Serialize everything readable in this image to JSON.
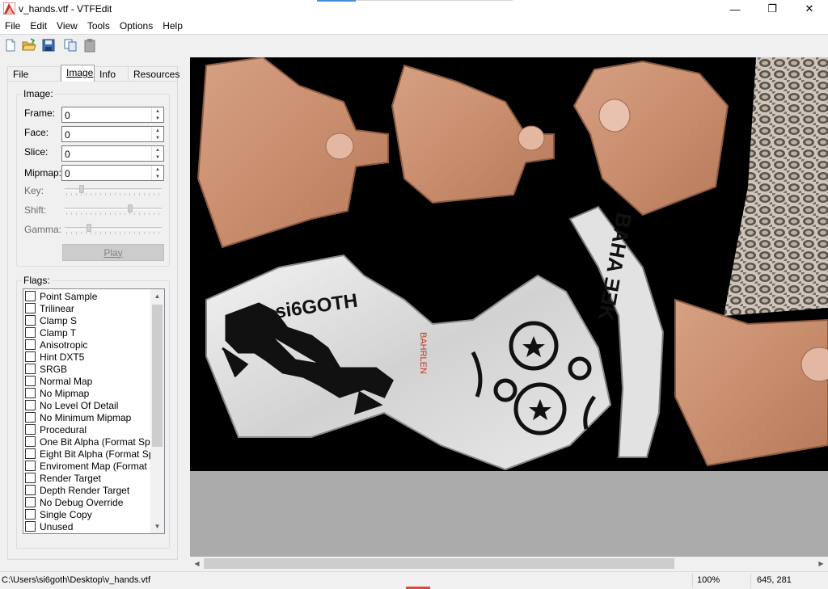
{
  "window": {
    "title": "v_hands.vtf - VTFEdit",
    "minimize_glyph": "—",
    "maximize_glyph": "❐",
    "close_glyph": "✕"
  },
  "menu": [
    {
      "label": "File"
    },
    {
      "label": "Edit"
    },
    {
      "label": "View"
    },
    {
      "label": "Tools"
    },
    {
      "label": "Options"
    },
    {
      "label": "Help"
    }
  ],
  "toolbar": {
    "icons": [
      "new-file-icon",
      "open-folder-icon",
      "save-disk-icon",
      "copy-icon",
      "paste-icon"
    ]
  },
  "tabs": [
    {
      "label": "File System"
    },
    {
      "label": "Image",
      "active": true
    },
    {
      "label": "Info"
    },
    {
      "label": "Resources"
    }
  ],
  "image_group": {
    "title": "Image:",
    "frame_label": "Frame:",
    "frame_value": "0",
    "face_label": "Face:",
    "face_value": "0",
    "slice_label": "Slice:",
    "slice_value": "0",
    "mipmap_label": "Mipmap:",
    "mipmap_value": "0",
    "key_label": "Key:",
    "key_level": 0.16,
    "shift_label": "Shift:",
    "shift_level": 0.68,
    "gamma_label": "Gamma:",
    "gamma_level": 0.24,
    "play_label": "Play"
  },
  "flags_group": {
    "title": "Flags:",
    "items": [
      {
        "label": "Point Sample",
        "checked": false
      },
      {
        "label": "Trilinear",
        "checked": false
      },
      {
        "label": "Clamp S",
        "checked": false
      },
      {
        "label": "Clamp T",
        "checked": false
      },
      {
        "label": "Anisotropic",
        "checked": false
      },
      {
        "label": "Hint DXT5",
        "checked": false
      },
      {
        "label": "SRGB",
        "checked": false
      },
      {
        "label": "Normal Map",
        "checked": false
      },
      {
        "label": "No Mipmap",
        "checked": false
      },
      {
        "label": "No Level Of Detail",
        "checked": false
      },
      {
        "label": "No Minimum Mipmap",
        "checked": false
      },
      {
        "label": "Procedural",
        "checked": false
      },
      {
        "label": "One Bit Alpha (Format Spec",
        "checked": false
      },
      {
        "label": "Eight Bit Alpha (Format Spec",
        "checked": false
      },
      {
        "label": "Enviroment Map (Format Sp",
        "checked": false
      },
      {
        "label": "Render Target",
        "checked": false
      },
      {
        "label": "Depth Render Target",
        "checked": false
      },
      {
        "label": "No Debug Override",
        "checked": false
      },
      {
        "label": "Single Copy",
        "checked": false
      },
      {
        "label": "Unused",
        "checked": false
      }
    ]
  },
  "texture": {
    "text_si6goth": "si6GOTH",
    "text_bahrlen": "BAHRLEN",
    "text_sleeve": "BAHA ƎƎK"
  },
  "status": {
    "path": "C:\\Users\\si6goth\\Desktop\\v_hands.vtf",
    "zoom": "100%",
    "coords": "645, 281"
  },
  "colors": {
    "skin": "#c98e6e",
    "fabric": "#dedede",
    "viewport_bg": "#ababab",
    "title_accent": "#4a90d9"
  }
}
